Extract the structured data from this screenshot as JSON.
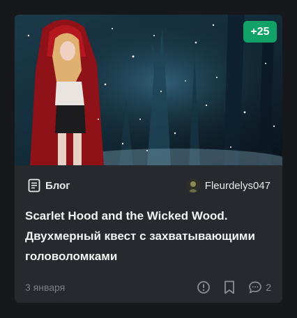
{
  "card": {
    "badge": "+25",
    "category": {
      "label": "Блог",
      "icon": "document-icon"
    },
    "author": {
      "name": "Fleurdelys047",
      "avatar": "user-avatar"
    },
    "title": "Scarlet Hood and the Wicked Wood. Двухмерный квест с захватывающими головоломками",
    "date": "3 января",
    "actions": {
      "report_icon": "exclamation-circle-icon",
      "bookmark_icon": "bookmark-icon",
      "comments_icon": "comment-icon",
      "comments_count": "2"
    }
  },
  "colors": {
    "background": "#16181b",
    "card": "#26292d",
    "badge": "#10a267",
    "text_primary": "#f2f3f4",
    "text_muted": "#7c8087"
  }
}
